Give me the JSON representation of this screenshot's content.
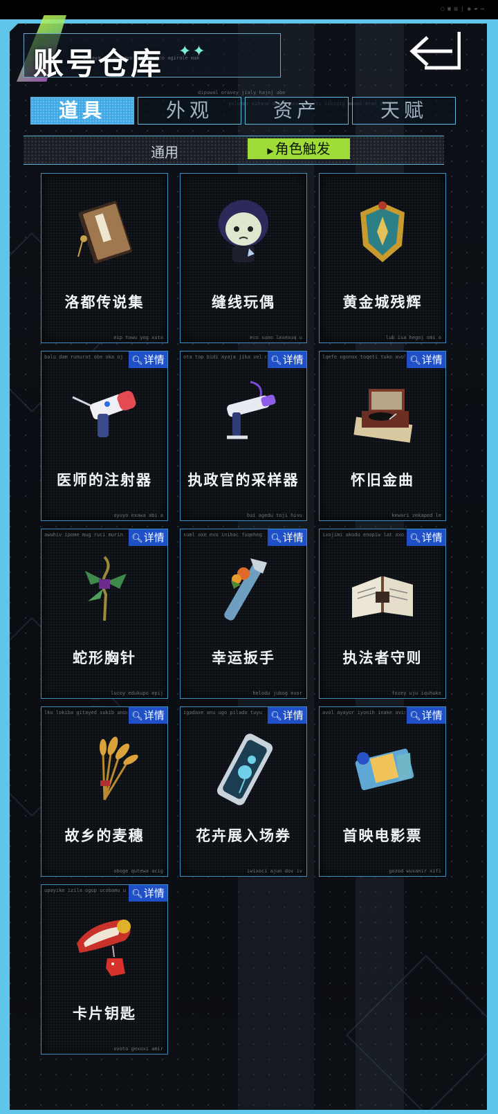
{
  "title": "账号仓库",
  "title_stars": "✦✦",
  "tabs": [
    {
      "label": "道具",
      "active": true
    },
    {
      "label": "外观",
      "active": false
    },
    {
      "label": "资产",
      "active": false
    },
    {
      "label": "天赋",
      "active": false
    }
  ],
  "subtabs": {
    "general": "通用",
    "character": "角色触发"
  },
  "detail_label": "详情",
  "items": [
    {
      "name": "洛都传说集",
      "icon": "legend-book-icon",
      "show_detail": false
    },
    {
      "name": "缝线玩偶",
      "icon": "stitched-doll-icon",
      "show_detail": false
    },
    {
      "name": "黄金城残辉",
      "icon": "golden-crest-icon",
      "show_detail": false
    },
    {
      "name": "医师的注射器",
      "icon": "syringe-icon",
      "show_detail": true
    },
    {
      "name": "执政官的采样器",
      "icon": "sampler-icon",
      "show_detail": true
    },
    {
      "name": "怀旧金曲",
      "icon": "record-player-icon",
      "show_detail": true
    },
    {
      "name": "蛇形胸针",
      "icon": "snake-brooch-icon",
      "show_detail": true
    },
    {
      "name": "幸运扳手",
      "icon": "wrench-icon",
      "show_detail": true
    },
    {
      "name": "执法者守则",
      "icon": "open-book-icon",
      "show_detail": true
    },
    {
      "name": "故乡的麦穗",
      "icon": "wheat-icon",
      "show_detail": true
    },
    {
      "name": "花卉展入场券",
      "icon": "flower-ticket-icon",
      "show_detail": true
    },
    {
      "name": "首映电影票",
      "icon": "movie-ticket-icon",
      "show_detail": true
    },
    {
      "name": "卡片钥匙",
      "icon": "card-key-icon",
      "show_detail": true
    }
  ],
  "colors": {
    "frame": "#5fc6ea",
    "tab_active": "#3ea8e6",
    "subtab_active": "#9fdc3a",
    "detail_badge": "#1f50c8"
  }
}
